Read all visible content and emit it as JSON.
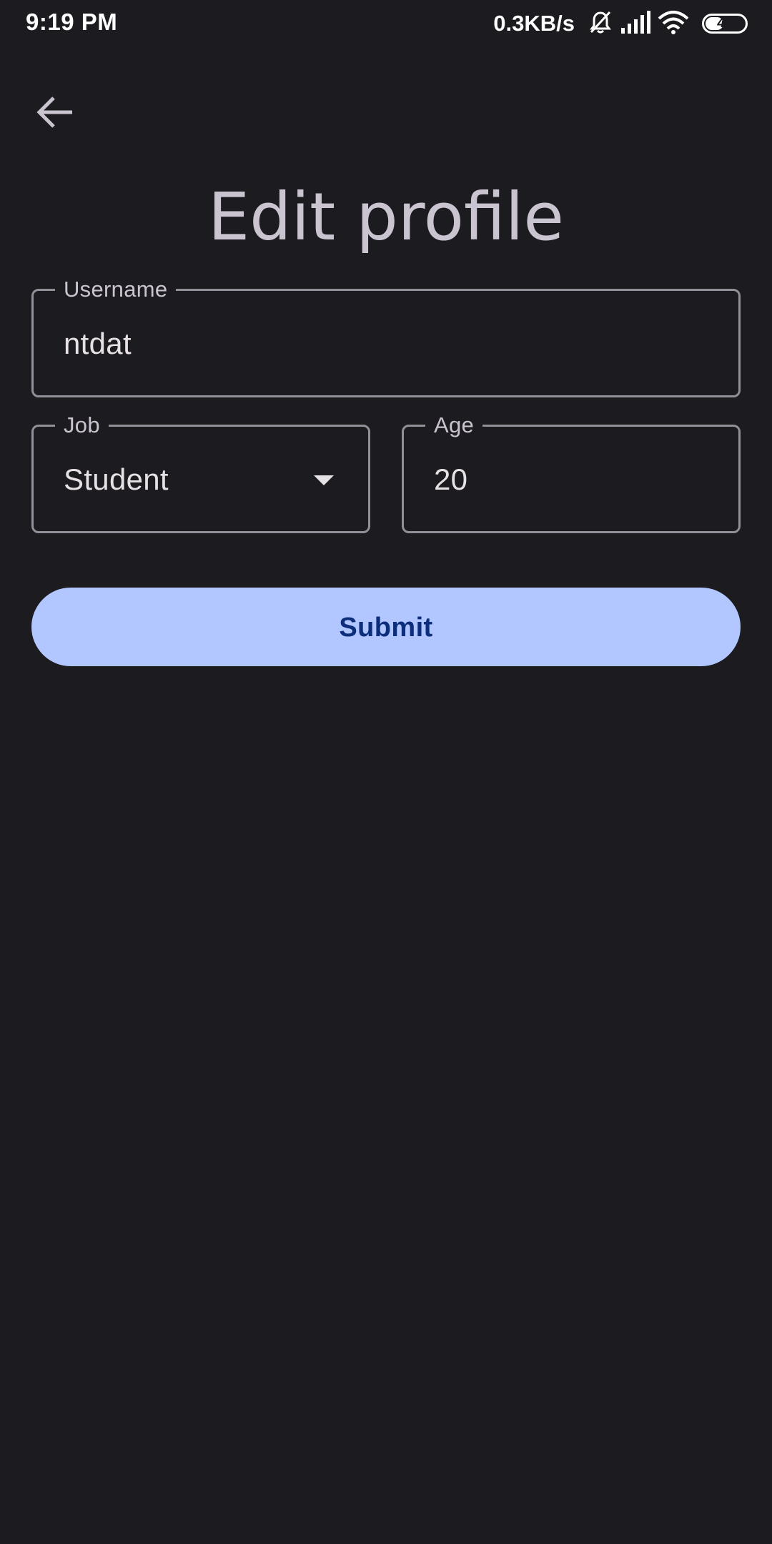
{
  "status_bar": {
    "time": "9:19 PM",
    "net_speed": "0.3KB/s",
    "battery_level": "49",
    "battery_fraction": 0.49,
    "icons": [
      "bell-muted-icon",
      "signal-icon",
      "wifi-icon",
      "battery-icon"
    ]
  },
  "header": {
    "back_icon": "arrow-back-icon",
    "title": "Edit profile"
  },
  "form": {
    "username": {
      "label": "Username",
      "value": "ntdat"
    },
    "job": {
      "label": "Job",
      "value": "Student",
      "icon": "dropdown-arrow-icon"
    },
    "age": {
      "label": "Age",
      "value": "20"
    },
    "submit_label": "Submit"
  },
  "colors": {
    "background": "#1c1b1f",
    "outline": "#938f99",
    "title": "#cac4d0",
    "button_bg": "#b2c6ff",
    "button_text": "#0d2e7a"
  }
}
